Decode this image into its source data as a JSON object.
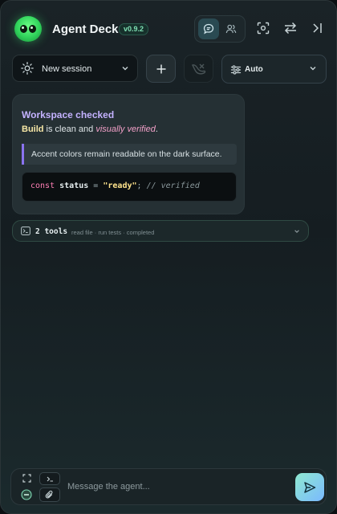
{
  "header": {
    "app_title": "Agent Deck",
    "version": "v0.9.2",
    "icons": [
      "logo-blob",
      "chat-bubble-icon",
      "users-icon",
      "capture-icon",
      "swap-icon",
      "collapse-panel-icon"
    ]
  },
  "toolbar": {
    "session_label": "New session",
    "model_label": "Auto",
    "icons": [
      "sun-icon",
      "chevron-down-icon",
      "plus-icon",
      "clear-icon",
      "sliders-icon"
    ]
  },
  "message": {
    "title": "Workspace checked",
    "body_bold": "Build",
    "body_mid": " is clean and ",
    "body_italic": "visually verified",
    "body_end": ".",
    "quote": "Accent colors remain readable on the dark surface.",
    "code": {
      "keyword": "const",
      "identifier": "status",
      "operator": "=",
      "string": "\"ready\"",
      "punct": ";",
      "comment": "// verified"
    }
  },
  "tools": {
    "count_label": "2 tools",
    "meta": "read file · run tests · completed"
  },
  "composer": {
    "placeholder": "Message the agent...",
    "icons": [
      "expand-icon",
      "terminal-icon",
      "minus-circle-icon",
      "paperclip-icon",
      "send-icon"
    ]
  },
  "colors": {
    "accent_purple": "#c4b2ff",
    "quote_border": "#8a73f0",
    "send_gradient_start": "#8fe9d0",
    "send_gradient_end": "#7ab9ff",
    "brand_green": "#2fd25a"
  }
}
